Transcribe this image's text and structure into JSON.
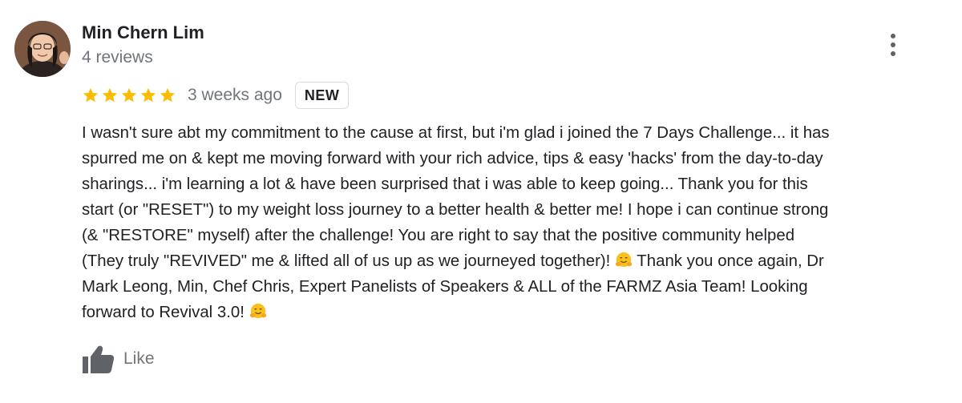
{
  "review": {
    "author_name": "Min Chern Lim",
    "review_count": "4 reviews",
    "rating": 5,
    "rating_max": 5,
    "time_ago": "3 weeks ago",
    "badge": "NEW",
    "body_lines": [
      "I wasn't sure abt my commitment to the cause at first, but i'm glad i joined the 7 Days Challenge... it has",
      "spurred me on & kept me moving forward with your rich advice, tips & easy 'hacks' from the day-to-day",
      "sharings... i'm learning a lot & have been surprised that i was able to keep going... Thank you for this",
      "start (or \"RESET\") to my weight loss journey to a better health & better me! I hope i can continue strong",
      "(& \"RESTORE\" myself) after the challenge! You are right to say that the positive community helped",
      "(They truly \"REVIVED\" me & lifted all of us up as we journeyed together)! ",
      " Thank you once again, Dr",
      "Mark Leong, Min, Chef Chris, Expert Panelists of Speakers & ALL of the FARMZ Asia Team! Looking",
      "forward to Revival 3.0! "
    ],
    "like_label": "Like"
  },
  "icons": {
    "avatar": "user-photo",
    "more": "more-vertical-icon",
    "star": "star-icon",
    "emoji": "hugging-face-emoji",
    "like": "thumbs-up-icon"
  },
  "colors": {
    "star": "#fbbc04",
    "secondary_text": "#70757a",
    "primary_text": "#202124",
    "badge_border": "#dadce0",
    "icon_gray": "#5f6368"
  }
}
